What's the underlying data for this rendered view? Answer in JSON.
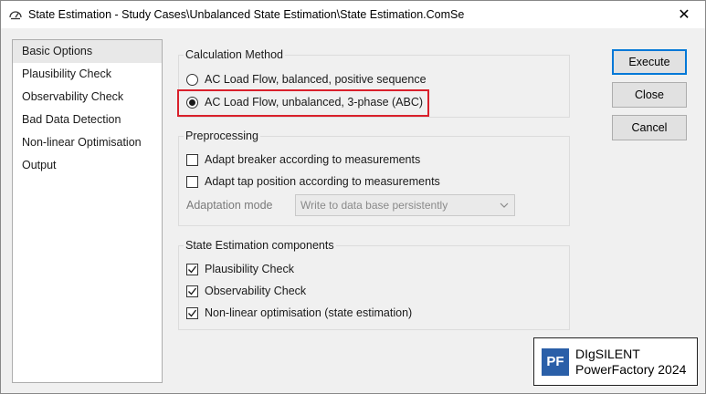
{
  "window": {
    "title": "State Estimation - Study Cases\\Unbalanced State Estimation\\State Estimation.ComSe",
    "close_glyph": "✕"
  },
  "nav": {
    "items": [
      {
        "label": "Basic Options",
        "selected": true
      },
      {
        "label": "Plausibility Check",
        "selected": false
      },
      {
        "label": "Observability Check",
        "selected": false
      },
      {
        "label": "Bad Data Detection",
        "selected": false
      },
      {
        "label": "Non-linear Optimisation",
        "selected": false
      },
      {
        "label": "Output",
        "selected": false
      }
    ]
  },
  "calculation_method": {
    "legend": "Calculation Method",
    "options": [
      {
        "label": "AC Load Flow, balanced, positive sequence",
        "selected": false
      },
      {
        "label": "AC Load Flow, unbalanced, 3-phase (ABC)",
        "selected": true
      }
    ]
  },
  "preprocessing": {
    "legend": "Preprocessing",
    "adapt_breaker": {
      "label": "Adapt breaker according to measurements",
      "checked": false
    },
    "adapt_tap": {
      "label": "Adapt tap position according to measurements",
      "checked": false
    },
    "adaptation_mode_label": "Adaptation mode",
    "adaptation_mode_value": "Write to data base persistently"
  },
  "components": {
    "legend": "State Estimation components",
    "items": [
      {
        "label": "Plausibility Check",
        "checked": true
      },
      {
        "label": "Observability Check",
        "checked": true
      },
      {
        "label": "Non-linear optimisation (state estimation)",
        "checked": true
      }
    ]
  },
  "buttons": {
    "execute": "Execute",
    "close": "Close",
    "cancel": "Cancel"
  },
  "brand": {
    "logo_text": "PF",
    "line1": "DIgSILENT",
    "line2": "PowerFactory 2024"
  },
  "colors": {
    "highlight": "#d9202b",
    "default_button_border": "#0078d7",
    "logo_bg": "#2a5fa8"
  }
}
